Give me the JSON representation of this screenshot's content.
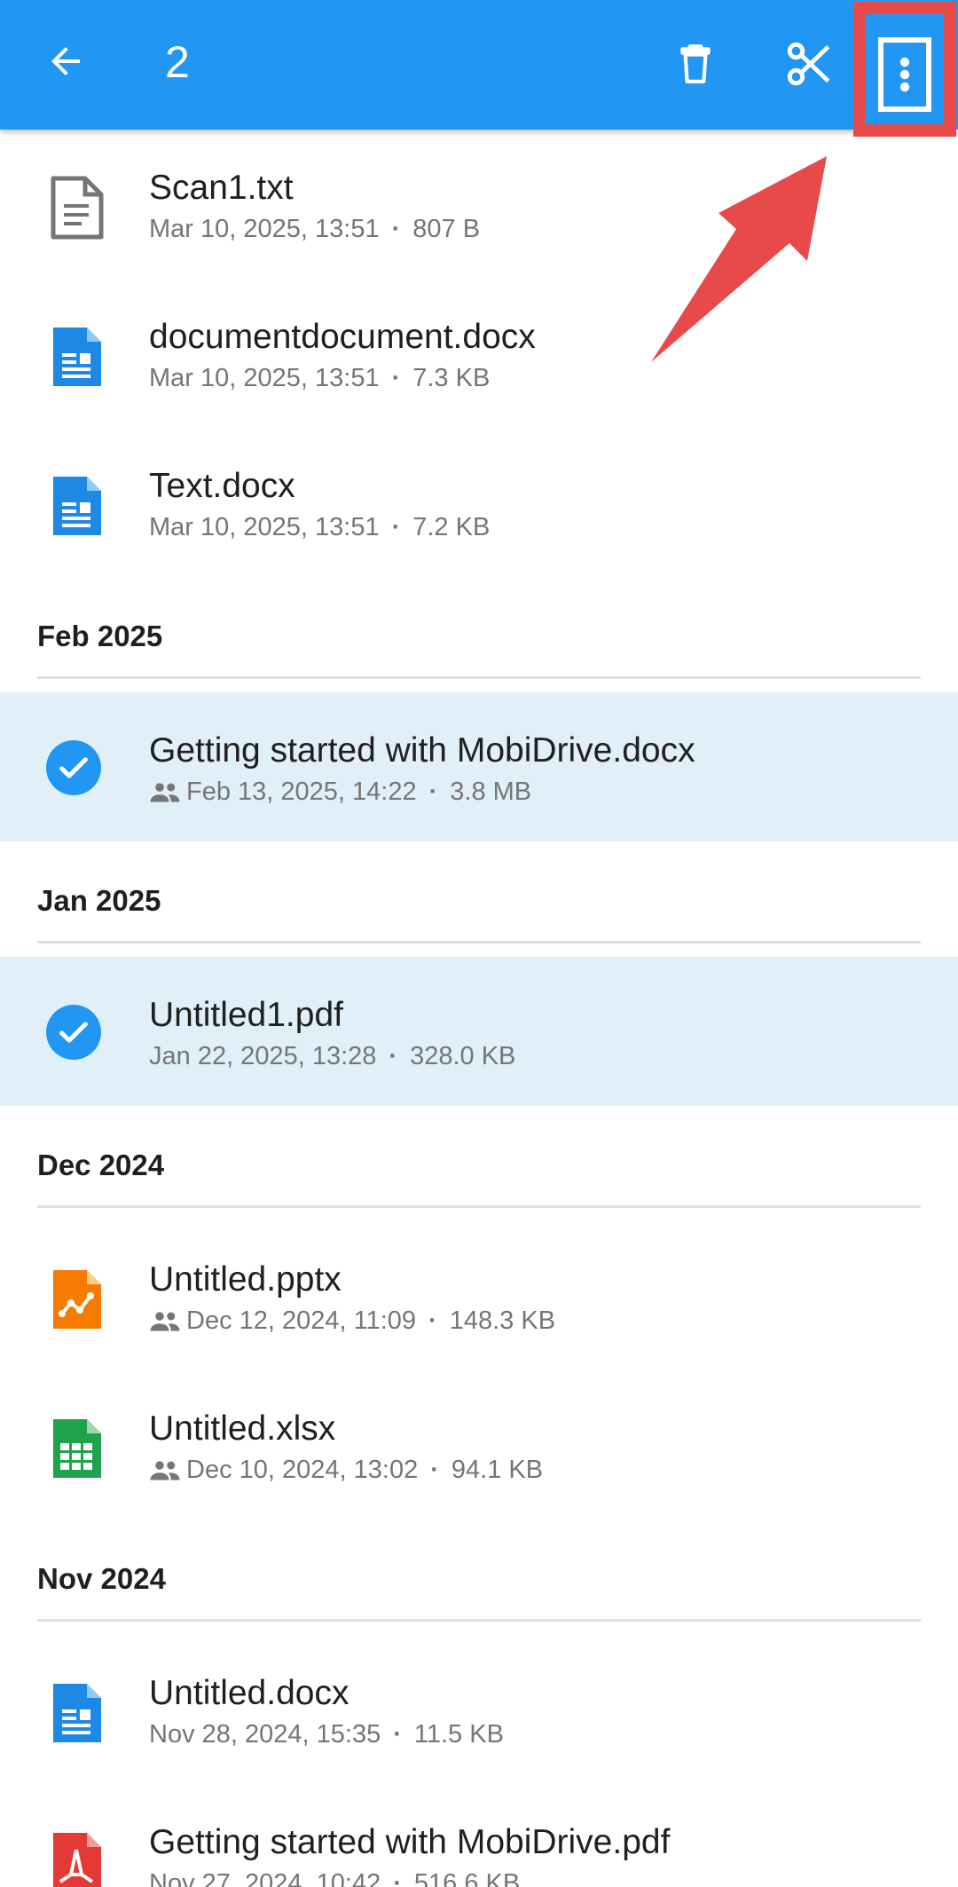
{
  "appbar": {
    "selected_count": "2",
    "icons": [
      "arrow-back-icon",
      "trash-icon",
      "scissors-icon",
      "more-vertical-icon"
    ],
    "background": "#2196f3"
  },
  "colors": {
    "accent": "#2196f3",
    "selected_row": "#e1eff9",
    "annotation": "#e84a4a"
  },
  "files_top": [
    {
      "name": "Scan1.txt",
      "date": "Mar 10, 2025, 13:51",
      "size": "807 B",
      "type": "txt",
      "shared": false,
      "selected": false
    },
    {
      "name": "documentdocument.docx",
      "date": "Mar 10, 2025, 13:51",
      "size": "7.3 KB",
      "type": "docx",
      "shared": false,
      "selected": false
    },
    {
      "name": "Text.docx",
      "date": "Mar 10, 2025, 13:51",
      "size": "7.2 KB",
      "type": "docx",
      "shared": false,
      "selected": false
    }
  ],
  "sections": [
    {
      "title": "Feb 2025",
      "files": [
        {
          "name": "Getting started with MobiDrive.docx",
          "date": "Feb 13, 2025, 14:22",
          "size": "3.8 MB",
          "type": "docx",
          "shared": true,
          "selected": true
        }
      ]
    },
    {
      "title": "Jan 2025",
      "files": [
        {
          "name": "Untitled1.pdf",
          "date": "Jan 22, 2025, 13:28",
          "size": "328.0 KB",
          "type": "pdf",
          "shared": false,
          "selected": true
        }
      ]
    },
    {
      "title": "Dec 2024",
      "files": [
        {
          "name": "Untitled.pptx",
          "date": "Dec 12, 2024, 11:09",
          "size": "148.3 KB",
          "type": "pptx",
          "shared": true,
          "selected": false
        },
        {
          "name": "Untitled.xlsx",
          "date": "Dec 10, 2024, 13:02",
          "size": "94.1 KB",
          "type": "xlsx",
          "shared": true,
          "selected": false
        }
      ]
    },
    {
      "title": "Nov 2024",
      "files": [
        {
          "name": "Untitled.docx",
          "date": "Nov 28, 2024, 15:35",
          "size": "11.5 KB",
          "type": "docx",
          "shared": false,
          "selected": false
        },
        {
          "name": "Getting started with MobiDrive.pdf",
          "date": "Nov 27, 2024, 10:42",
          "size": "516.6 KB",
          "type": "pdf",
          "shared": false,
          "selected": false
        }
      ]
    }
  ]
}
